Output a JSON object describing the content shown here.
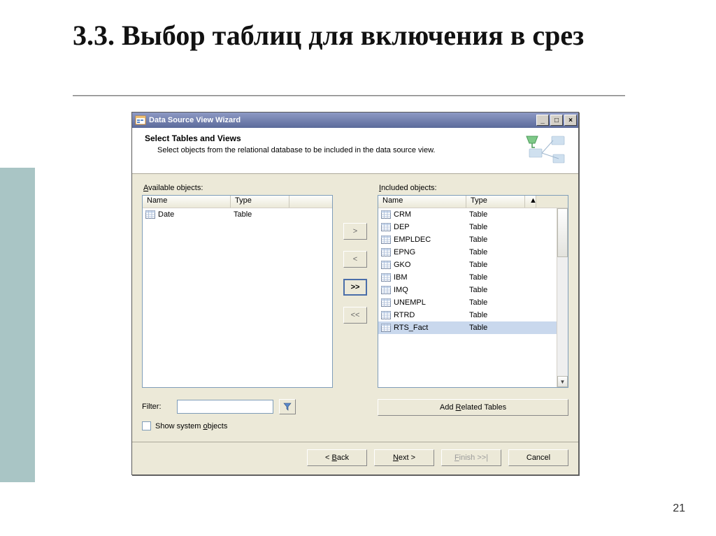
{
  "slide": {
    "title": "3.3. Выбор таблиц для включения в срез",
    "page": "21"
  },
  "window": {
    "title": "Data Source View Wizard"
  },
  "header": {
    "title": "Select Tables and Views",
    "subtitle": "Select objects from the relational database to be included in the data source view."
  },
  "labels": {
    "available_ul": "A",
    "available_rest": "vailable objects:",
    "included_ul": "I",
    "included_rest": "ncluded objects:",
    "filter_pre": "Fil",
    "filter_ul": "t",
    "filter_post": "er:",
    "showsys_pre": "Show system ",
    "showsys_ul": "o",
    "showsys_post": "bjects"
  },
  "columns": {
    "name": "Name",
    "type": "Type"
  },
  "available": [
    {
      "name": "Date",
      "type": "Table",
      "selected": false
    }
  ],
  "included": [
    {
      "name": "CRM",
      "type": "Table",
      "selected": false
    },
    {
      "name": "DEP",
      "type": "Table",
      "selected": false
    },
    {
      "name": "EMPLDEC",
      "type": "Table",
      "selected": false
    },
    {
      "name": "EPNG",
      "type": "Table",
      "selected": false
    },
    {
      "name": "GKO",
      "type": "Table",
      "selected": false
    },
    {
      "name": "IBM",
      "type": "Table",
      "selected": false
    },
    {
      "name": "IMQ",
      "type": "Table",
      "selected": false
    },
    {
      "name": "UNEMPL",
      "type": "Table",
      "selected": false
    },
    {
      "name": "RTRD",
      "type": "Table",
      "selected": false
    },
    {
      "name": "RTS_Fact",
      "type": "Table",
      "selected": true
    }
  ],
  "buttons": {
    "move_right": ">",
    "move_left": "<",
    "move_all_right": ">>",
    "move_all_left": "<<",
    "add_related_pre": "Add ",
    "add_related_ul": "R",
    "add_related_post": "elated Tables",
    "back_pre": "< ",
    "back_ul": "B",
    "back_post": "ack",
    "next_ul": "N",
    "next_post": "ext >",
    "finish_ul": "F",
    "finish_post": "inish >>|",
    "cancel": "Cancel"
  }
}
